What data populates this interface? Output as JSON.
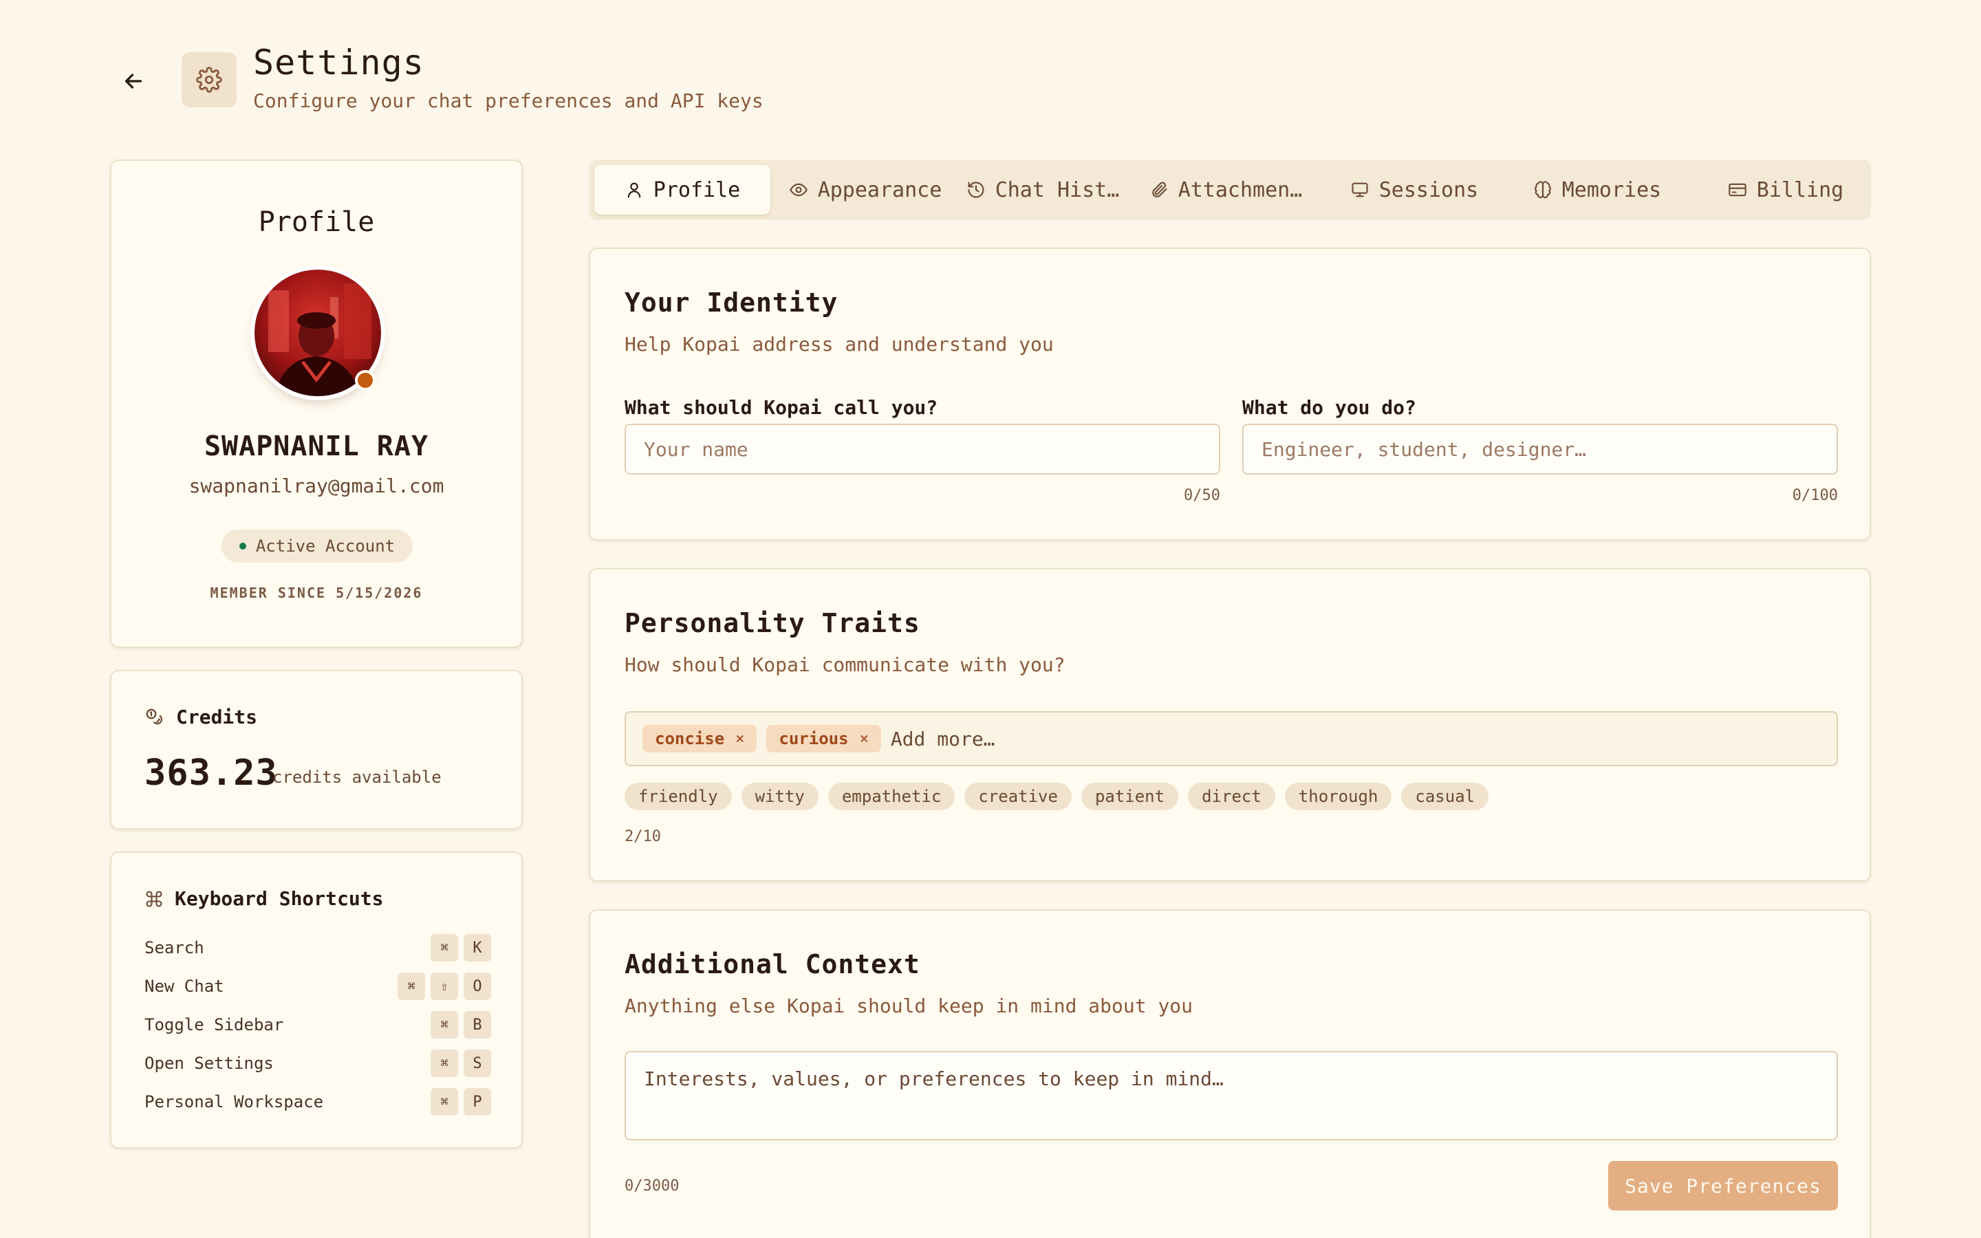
{
  "header": {
    "title": "Settings",
    "subtitle": "Configure your chat preferences and API keys"
  },
  "profile": {
    "heading": "Profile",
    "name": "SWAPNANIL RAY",
    "email": "swapnanilray@gmail.com",
    "status": "Active Account",
    "member_since": "MEMBER SINCE 5/15/2026"
  },
  "credits": {
    "title": "Credits",
    "amount": "363.23",
    "label": "credits available"
  },
  "shortcuts": {
    "title": "Keyboard Shortcuts",
    "items": [
      {
        "label": "Search",
        "keys": [
          "⌘",
          "K"
        ]
      },
      {
        "label": "New Chat",
        "keys": [
          "⌘",
          "⇧",
          "O"
        ]
      },
      {
        "label": "Toggle Sidebar",
        "keys": [
          "⌘",
          "B"
        ]
      },
      {
        "label": "Open Settings",
        "keys": [
          "⌘",
          "S"
        ]
      },
      {
        "label": "Personal Workspace",
        "keys": [
          "⌘",
          "P"
        ]
      }
    ]
  },
  "tabs": [
    {
      "label": "Profile",
      "icon": "user-icon",
      "active": true
    },
    {
      "label": "Appearance",
      "icon": "eye-icon",
      "active": false
    },
    {
      "label": "Chat Hist…",
      "icon": "history-icon",
      "active": false
    },
    {
      "label": "Attachmen…",
      "icon": "paperclip-icon",
      "active": false
    },
    {
      "label": "Sessions",
      "icon": "monitor-icon",
      "active": false
    },
    {
      "label": "Memories",
      "icon": "brain-icon",
      "active": false
    },
    {
      "label": "Billing",
      "icon": "card-icon",
      "active": false
    }
  ],
  "identity": {
    "title": "Your Identity",
    "description": "Help Kopai address and understand you",
    "name_label": "What should Kopai call you?",
    "name_placeholder": "Your name",
    "name_counter": "0/50",
    "role_label": "What do you do?",
    "role_placeholder": "Engineer, student, designer…",
    "role_counter": "0/100"
  },
  "traits": {
    "title": "Personality Traits",
    "description": "How should Kopai communicate with you?",
    "selected": [
      "concise",
      "curious"
    ],
    "remove_glyph": "×",
    "add_placeholder": "Add more…",
    "suggestions": [
      "friendly",
      "witty",
      "empathetic",
      "creative",
      "patient",
      "direct",
      "thorough",
      "casual"
    ],
    "count": "2/10"
  },
  "context": {
    "title": "Additional Context",
    "description": "Anything else Kopai should keep in mind about you",
    "placeholder": "Interests, values, or preferences to keep in mind…",
    "count": "0/3000",
    "save_label": "Save Preferences"
  },
  "colors": {
    "background": "#fcf7ea",
    "accent": "#c45a10",
    "tag_text": "#a0481a",
    "save_button": "#e3ae82",
    "status_active": "#147a4a"
  }
}
